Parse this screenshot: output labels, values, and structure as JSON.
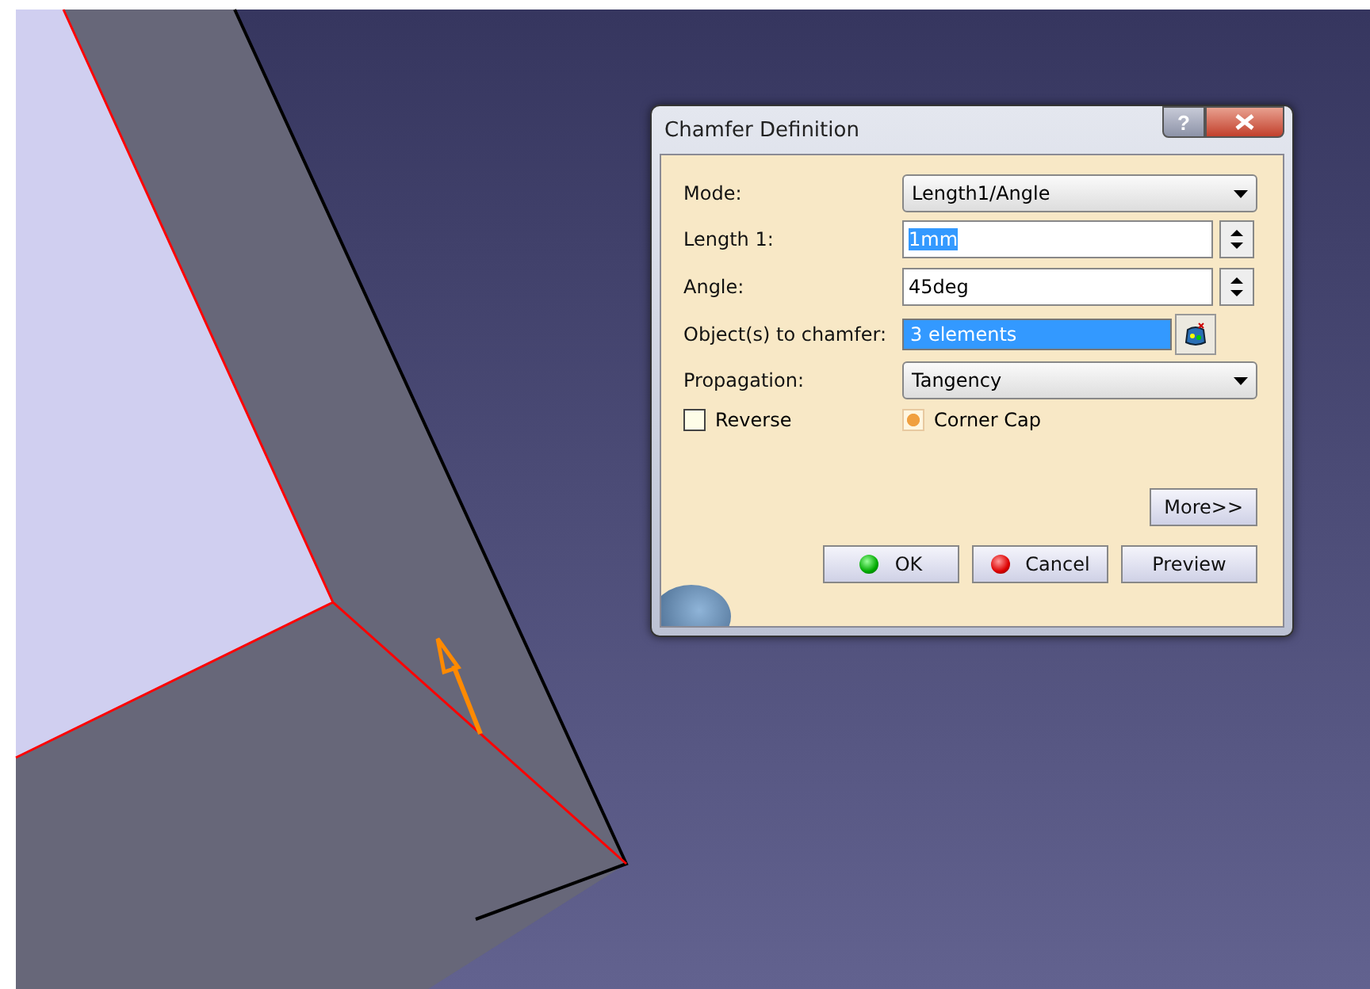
{
  "dialog": {
    "title": "Chamfer Definition",
    "help": "?",
    "fields": [
      {
        "kind": "dropdown",
        "label": "Mode:",
        "value": "Length1/Angle"
      },
      {
        "kind": "spinner",
        "label": "Length 1:",
        "value": "1mm",
        "selected": true
      },
      {
        "kind": "spinner",
        "label": "Angle:",
        "value": "45deg",
        "selected": false
      },
      {
        "kind": "selection",
        "label": "Object(s) to chamfer:",
        "value": "3 elements",
        "selected": true
      },
      {
        "kind": "dropdown",
        "label": "Propagation:",
        "value": "Tangency"
      }
    ],
    "checkboxes": [
      {
        "label": "Reverse",
        "checked": false
      },
      {
        "label": "Corner Cap",
        "checked": true
      }
    ],
    "more_button": "More>>",
    "buttons": [
      {
        "kind": "ok",
        "label": "OK"
      },
      {
        "kind": "cancel",
        "label": "Cancel"
      },
      {
        "kind": "plain",
        "label": "Preview"
      }
    ]
  }
}
